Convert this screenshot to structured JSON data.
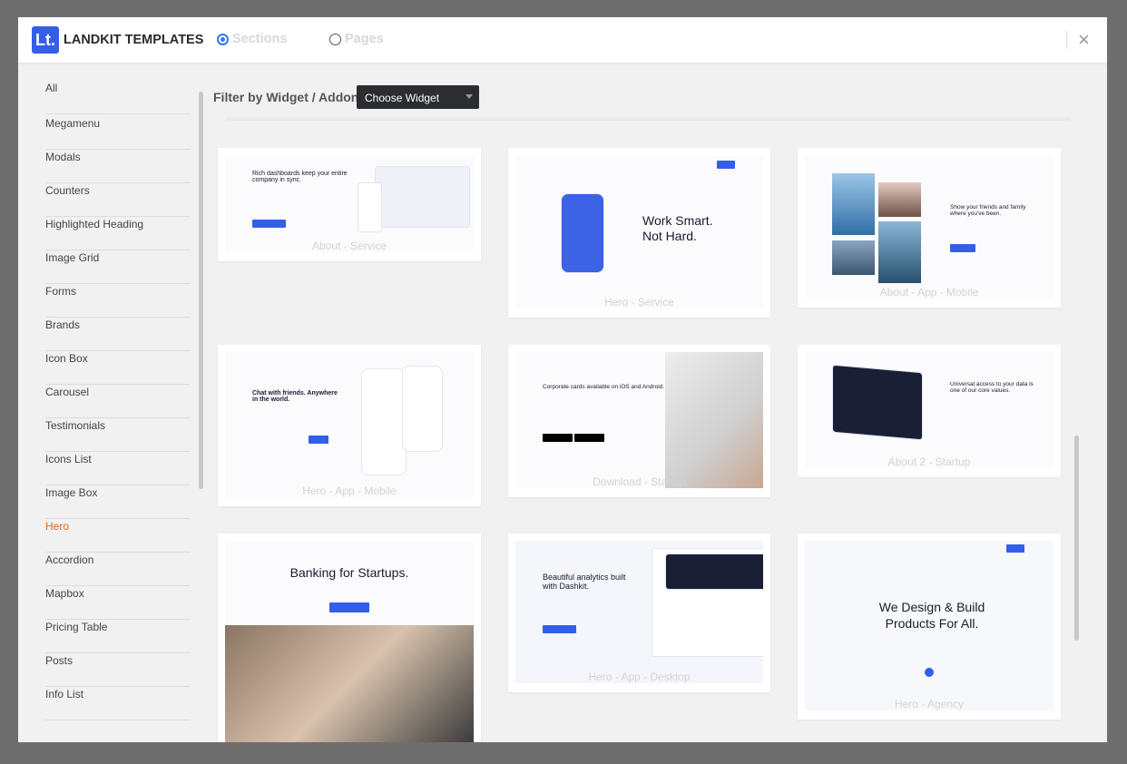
{
  "header": {
    "logo": "Lt.",
    "title": "LANDKIT TEMPLATES",
    "modes": [
      {
        "label": "Sections",
        "selected": true
      },
      {
        "label": "Pages",
        "selected": false
      }
    ],
    "close": "×"
  },
  "sidebar": {
    "items": [
      "All",
      "Megamenu",
      "Modals",
      "Counters",
      "Highlighted Heading",
      "Image Grid",
      "Forms",
      "Brands",
      "Icon Box",
      "Carousel",
      "Testimonials",
      "Icons List",
      "Image Box",
      "Hero",
      "Accordion",
      "Mapbox",
      "Pricing Table",
      "Posts",
      "Info List"
    ],
    "active": "Hero"
  },
  "filter": {
    "label": "Filter by Widget / Addon",
    "select_value": "Choose Widget"
  },
  "cards": [
    {
      "label": "About - Service",
      "headline": "Rich dashboards keep your entire company in sync."
    },
    {
      "label": "Hero - Service",
      "headline": "Work Smart. Not Hard."
    },
    {
      "label": "About - App - Mobile",
      "headline": "Show your friends and family where you've been."
    },
    {
      "label": "Hero - App - Mobile",
      "headline": "Chat with friends. Anywhere in the world."
    },
    {
      "label": "Download - Startup",
      "headline": "Corporate cards available on iOS and Android."
    },
    {
      "label": "About 2 - Startup",
      "headline": "Universal access to your data is one of our core values."
    },
    {
      "label": "",
      "headline": "Banking for Startups."
    },
    {
      "label": "Hero - App - Desktop",
      "headline": "Beautiful analytics built with Dashkit."
    },
    {
      "label": "Hero - Agency",
      "headline": "We Design & Build Products For All."
    }
  ],
  "colors": {
    "brand": "#335eea",
    "active": "#e0691a",
    "radio": "#2e7de1"
  }
}
